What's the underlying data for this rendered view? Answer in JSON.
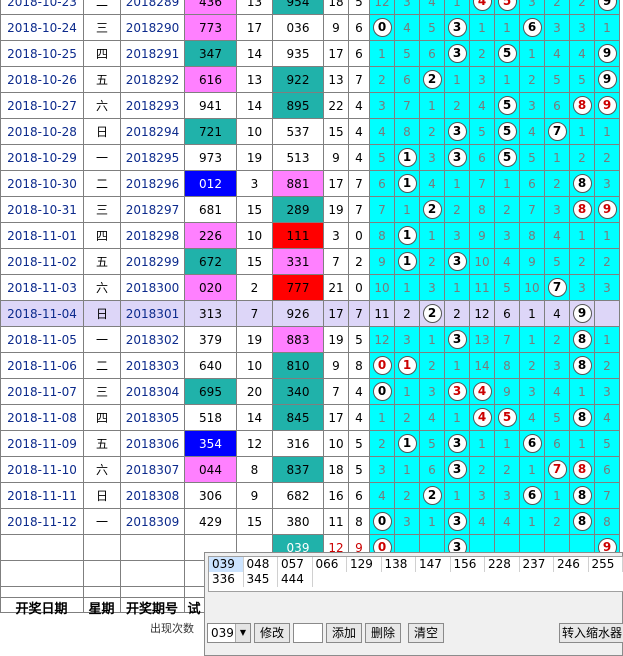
{
  "rows": [
    {
      "date": "2018-10-23",
      "wk": "二",
      "per": "2018289",
      "t": "436",
      "s": "13",
      "k": "954",
      "a": "18",
      "b": "5",
      "c": [
        {
          "v": "12"
        },
        {
          "v": "3"
        },
        {
          "v": "4"
        },
        {
          "v": "1"
        },
        {
          "v": "4",
          "ball": "red"
        },
        {
          "v": "5",
          "ball": "red"
        },
        {
          "v": "3"
        },
        {
          "v": "2"
        },
        {
          "v": "2"
        },
        {
          "v": "9",
          "ball": "blk"
        }
      ],
      "tc": "#ff80ff",
      "kc": "#20b2aa"
    },
    {
      "date": "2018-10-24",
      "wk": "三",
      "per": "2018290",
      "t": "773",
      "s": "17",
      "k": "036",
      "a": "9",
      "b": "6",
      "c": [
        {
          "v": "0",
          "ball": "blk"
        },
        {
          "v": "4"
        },
        {
          "v": "5"
        },
        {
          "v": "3",
          "ball": "blk"
        },
        {
          "v": "1"
        },
        {
          "v": "1"
        },
        {
          "v": "6",
          "ball": "blk"
        },
        {
          "v": "3"
        },
        {
          "v": "3"
        },
        {
          "v": "1"
        }
      ],
      "tc": "#ff80ff",
      "kc": "#ffffff"
    },
    {
      "date": "2018-10-25",
      "wk": "四",
      "per": "2018291",
      "t": "347",
      "s": "14",
      "k": "935",
      "a": "17",
      "b": "6",
      "c": [
        {
          "v": "1"
        },
        {
          "v": "5"
        },
        {
          "v": "6"
        },
        {
          "v": "3",
          "ball": "blk"
        },
        {
          "v": "2"
        },
        {
          "v": "5",
          "ball": "blk"
        },
        {
          "v": "1"
        },
        {
          "v": "4"
        },
        {
          "v": "4"
        },
        {
          "v": "9",
          "ball": "blk"
        }
      ],
      "tc": "#20b2aa",
      "kc": "#ffffff"
    },
    {
      "date": "2018-10-26",
      "wk": "五",
      "per": "2018292",
      "t": "616",
      "s": "13",
      "k": "922",
      "a": "13",
      "b": "7",
      "c": [
        {
          "v": "2"
        },
        {
          "v": "6"
        },
        {
          "v": "2",
          "ball": "blk"
        },
        {
          "v": "1"
        },
        {
          "v": "3"
        },
        {
          "v": "1"
        },
        {
          "v": "2"
        },
        {
          "v": "5"
        },
        {
          "v": "5"
        },
        {
          "v": "9",
          "ball": "blk"
        }
      ],
      "tc": "#ff80ff",
      "kc": "#20b2aa"
    },
    {
      "date": "2018-10-27",
      "wk": "六",
      "per": "2018293",
      "t": "941",
      "s": "14",
      "k": "895",
      "a": "22",
      "b": "4",
      "c": [
        {
          "v": "3"
        },
        {
          "v": "7"
        },
        {
          "v": "1"
        },
        {
          "v": "2"
        },
        {
          "v": "4"
        },
        {
          "v": "5",
          "ball": "blk"
        },
        {
          "v": "3"
        },
        {
          "v": "6"
        },
        {
          "v": "8",
          "ball": "red"
        },
        {
          "v": "9",
          "ball": "red"
        }
      ],
      "tc": "#ffffff",
      "kc": "#20b2aa"
    },
    {
      "date": "2018-10-28",
      "wk": "日",
      "per": "2018294",
      "t": "721",
      "s": "10",
      "k": "537",
      "a": "15",
      "b": "4",
      "c": [
        {
          "v": "4"
        },
        {
          "v": "8"
        },
        {
          "v": "2"
        },
        {
          "v": "3",
          "ball": "blk"
        },
        {
          "v": "5"
        },
        {
          "v": "5",
          "ball": "blk"
        },
        {
          "v": "4"
        },
        {
          "v": "7",
          "ball": "blk"
        },
        {
          "v": "1"
        },
        {
          "v": "1"
        }
      ],
      "tc": "#20b2aa",
      "kc": "#ffffff"
    },
    {
      "date": "2018-10-29",
      "wk": "一",
      "per": "2018295",
      "t": "973",
      "s": "19",
      "k": "513",
      "a": "9",
      "b": "4",
      "c": [
        {
          "v": "5"
        },
        {
          "v": "1",
          "ball": "blk"
        },
        {
          "v": "3"
        },
        {
          "v": "3",
          "ball": "blk"
        },
        {
          "v": "6"
        },
        {
          "v": "5",
          "ball": "blk"
        },
        {
          "v": "5"
        },
        {
          "v": "1"
        },
        {
          "v": "2"
        },
        {
          "v": "2"
        }
      ],
      "tc": "#ffffff",
      "kc": "#ffffff"
    },
    {
      "date": "2018-10-30",
      "wk": "二",
      "per": "2018296",
      "t": "012",
      "s": "3",
      "k": "881",
      "a": "17",
      "b": "7",
      "c": [
        {
          "v": "6"
        },
        {
          "v": "1",
          "ball": "blk"
        },
        {
          "v": "4"
        },
        {
          "v": "1"
        },
        {
          "v": "7"
        },
        {
          "v": "1"
        },
        {
          "v": "6"
        },
        {
          "v": "2"
        },
        {
          "v": "8",
          "ball": "blk"
        },
        {
          "v": "3"
        }
      ],
      "tc": "#0000ff",
      "kc": "#ff80ff"
    },
    {
      "date": "2018-10-31",
      "wk": "三",
      "per": "2018297",
      "t": "681",
      "s": "15",
      "k": "289",
      "a": "19",
      "b": "7",
      "c": [
        {
          "v": "7"
        },
        {
          "v": "1"
        },
        {
          "v": "2",
          "ball": "blk"
        },
        {
          "v": "2"
        },
        {
          "v": "8"
        },
        {
          "v": "2"
        },
        {
          "v": "7"
        },
        {
          "v": "3"
        },
        {
          "v": "8",
          "ball": "red"
        },
        {
          "v": "9",
          "ball": "red"
        }
      ],
      "tc": "#ffffff",
      "kc": "#20b2aa"
    },
    {
      "date": "2018-11-01",
      "wk": "四",
      "per": "2018298",
      "t": "226",
      "s": "10",
      "k": "111",
      "a": "3",
      "b": "0",
      "c": [
        {
          "v": "8"
        },
        {
          "v": "1",
          "ball": "blk"
        },
        {
          "v": "1"
        },
        {
          "v": "3"
        },
        {
          "v": "9"
        },
        {
          "v": "3"
        },
        {
          "v": "8"
        },
        {
          "v": "4"
        },
        {
          "v": "1"
        },
        {
          "v": "1"
        }
      ],
      "tc": "#ff80ff",
      "kc": "#ff0000"
    },
    {
      "date": "2018-11-02",
      "wk": "五",
      "per": "2018299",
      "t": "672",
      "s": "15",
      "k": "331",
      "a": "7",
      "b": "2",
      "c": [
        {
          "v": "9"
        },
        {
          "v": "1",
          "ball": "blk"
        },
        {
          "v": "2"
        },
        {
          "v": "3",
          "ball": "blk"
        },
        {
          "v": "10"
        },
        {
          "v": "4"
        },
        {
          "v": "9"
        },
        {
          "v": "5"
        },
        {
          "v": "2"
        },
        {
          "v": "2"
        }
      ],
      "tc": "#20b2aa",
      "kc": "#ff80ff"
    },
    {
      "date": "2018-11-03",
      "wk": "六",
      "per": "2018300",
      "t": "020",
      "s": "2",
      "k": "777",
      "a": "21",
      "b": "0",
      "c": [
        {
          "v": "10"
        },
        {
          "v": "1"
        },
        {
          "v": "3"
        },
        {
          "v": "1"
        },
        {
          "v": "11"
        },
        {
          "v": "5"
        },
        {
          "v": "10"
        },
        {
          "v": "7",
          "ball": "blk"
        },
        {
          "v": "3"
        },
        {
          "v": "3"
        }
      ],
      "tc": "#ff80ff",
      "kc": "#ff0000"
    },
    {
      "date": "2018-11-04",
      "wk": "日",
      "per": "2018301",
      "t": "313",
      "s": "7",
      "k": "926",
      "a": "17",
      "b": "7",
      "c": [
        {
          "v": "11"
        },
        {
          "v": "2"
        },
        {
          "v": "2",
          "ball": "blk"
        },
        {
          "v": "2"
        },
        {
          "v": "12"
        },
        {
          "v": "6"
        },
        {
          "v": "1"
        },
        {
          "v": "4"
        },
        {
          "v": "9",
          "ball": "blk"
        }
      ],
      "hl": true
    },
    {
      "date": "2018-11-05",
      "wk": "一",
      "per": "2018302",
      "t": "379",
      "s": "19",
      "k": "883",
      "a": "19",
      "b": "5",
      "c": [
        {
          "v": "12"
        },
        {
          "v": "3"
        },
        {
          "v": "1"
        },
        {
          "v": "3",
          "ball": "blk"
        },
        {
          "v": "13"
        },
        {
          "v": "7"
        },
        {
          "v": "1"
        },
        {
          "v": "2"
        },
        {
          "v": "8",
          "ball": "blk"
        },
        {
          "v": "1"
        }
      ],
      "tc": "#ffffff",
      "kc": "#ff80ff"
    },
    {
      "date": "2018-11-06",
      "wk": "二",
      "per": "2018303",
      "t": "640",
      "s": "10",
      "k": "810",
      "a": "9",
      "b": "8",
      "c": [
        {
          "v": "0",
          "ball": "red"
        },
        {
          "v": "1",
          "ball": "red"
        },
        {
          "v": "2"
        },
        {
          "v": "1"
        },
        {
          "v": "14"
        },
        {
          "v": "8"
        },
        {
          "v": "2"
        },
        {
          "v": "3"
        },
        {
          "v": "8",
          "ball": "blk"
        },
        {
          "v": "2"
        }
      ],
      "tc": "#ffffff",
      "kc": "#20b2aa"
    },
    {
      "date": "2018-11-07",
      "wk": "三",
      "per": "2018304",
      "t": "695",
      "s": "20",
      "k": "340",
      "a": "7",
      "b": "4",
      "c": [
        {
          "v": "0",
          "ball": "blk"
        },
        {
          "v": "1"
        },
        {
          "v": "3"
        },
        {
          "v": "3",
          "ball": "red"
        },
        {
          "v": "4",
          "ball": "red"
        },
        {
          "v": "9"
        },
        {
          "v": "3"
        },
        {
          "v": "4"
        },
        {
          "v": "1"
        },
        {
          "v": "3"
        }
      ],
      "tc": "#20b2aa",
      "kc": "#20b2aa"
    },
    {
      "date": "2018-11-08",
      "wk": "四",
      "per": "2018305",
      "t": "518",
      "s": "14",
      "k": "845",
      "a": "17",
      "b": "4",
      "c": [
        {
          "v": "1"
        },
        {
          "v": "2"
        },
        {
          "v": "4"
        },
        {
          "v": "1"
        },
        {
          "v": "4",
          "ball": "red"
        },
        {
          "v": "5",
          "ball": "red"
        },
        {
          "v": "4"
        },
        {
          "v": "5"
        },
        {
          "v": "8",
          "ball": "blk"
        },
        {
          "v": "4"
        }
      ],
      "tc": "#ffffff",
      "kc": "#20b2aa"
    },
    {
      "date": "2018-11-09",
      "wk": "五",
      "per": "2018306",
      "t": "354",
      "s": "12",
      "k": "316",
      "a": "10",
      "b": "5",
      "c": [
        {
          "v": "2"
        },
        {
          "v": "1",
          "ball": "blk"
        },
        {
          "v": "5"
        },
        {
          "v": "3",
          "ball": "blk"
        },
        {
          "v": "1"
        },
        {
          "v": "1"
        },
        {
          "v": "6",
          "ball": "blk"
        },
        {
          "v": "6"
        },
        {
          "v": "1"
        },
        {
          "v": "5"
        }
      ],
      "tc": "#0000ff",
      "kc": "#ffffff"
    },
    {
      "date": "2018-11-10",
      "wk": "六",
      "per": "2018307",
      "t": "044",
      "s": "8",
      "k": "837",
      "a": "18",
      "b": "5",
      "c": [
        {
          "v": "3"
        },
        {
          "v": "1"
        },
        {
          "v": "6"
        },
        {
          "v": "3",
          "ball": "blk"
        },
        {
          "v": "2"
        },
        {
          "v": "2"
        },
        {
          "v": "1"
        },
        {
          "v": "7",
          "ball": "red"
        },
        {
          "v": "8",
          "ball": "red"
        },
        {
          "v": "6"
        }
      ],
      "tc": "#ff80ff",
      "kc": "#20b2aa"
    },
    {
      "date": "2018-11-11",
      "wk": "日",
      "per": "2018308",
      "t": "306",
      "s": "9",
      "k": "682",
      "a": "16",
      "b": "6",
      "c": [
        {
          "v": "4"
        },
        {
          "v": "2"
        },
        {
          "v": "2",
          "ball": "blk"
        },
        {
          "v": "1"
        },
        {
          "v": "3"
        },
        {
          "v": "3"
        },
        {
          "v": "6",
          "ball": "blk"
        },
        {
          "v": "1"
        },
        {
          "v": "8",
          "ball": "blk"
        },
        {
          "v": "7"
        }
      ],
      "tc": "#ffffff",
      "kc": "#ffffff"
    },
    {
      "date": "2018-11-12",
      "wk": "一",
      "per": "2018309",
      "t": "429",
      "s": "15",
      "k": "380",
      "a": "11",
      "b": "8",
      "c": [
        {
          "v": "0",
          "ball": "blk"
        },
        {
          "v": "3"
        },
        {
          "v": "1"
        },
        {
          "v": "3",
          "ball": "blk"
        },
        {
          "v": "4"
        },
        {
          "v": "4"
        },
        {
          "v": "1"
        },
        {
          "v": "2"
        },
        {
          "v": "8",
          "ball": "blk"
        },
        {
          "v": "8"
        }
      ],
      "tc": "#ffffff",
      "kc": "#ffffff"
    }
  ],
  "forecast": {
    "k": "039",
    "a": "12",
    "b": "9",
    "balls": [
      {
        "i": 0,
        "v": "0"
      },
      {
        "i": 3,
        "v": "3"
      },
      {
        "i": 9,
        "v": "9"
      }
    ]
  },
  "headers": {
    "date": "开奖日期",
    "week": "星期",
    "period": "开奖期号",
    "test": "试"
  },
  "footer_text": "出现次数",
  "popup": {
    "row1": [
      "039",
      "048",
      "057",
      "066",
      "129",
      "138",
      "147",
      "156",
      "228",
      "237",
      "246",
      "255"
    ],
    "row2": [
      "336",
      "345",
      "444"
    ],
    "select_value": "039",
    "buttons": {
      "modify": "修改",
      "add": "添加",
      "delete": "删除",
      "clear": "清空",
      "transfer": "转入缩水器"
    }
  }
}
